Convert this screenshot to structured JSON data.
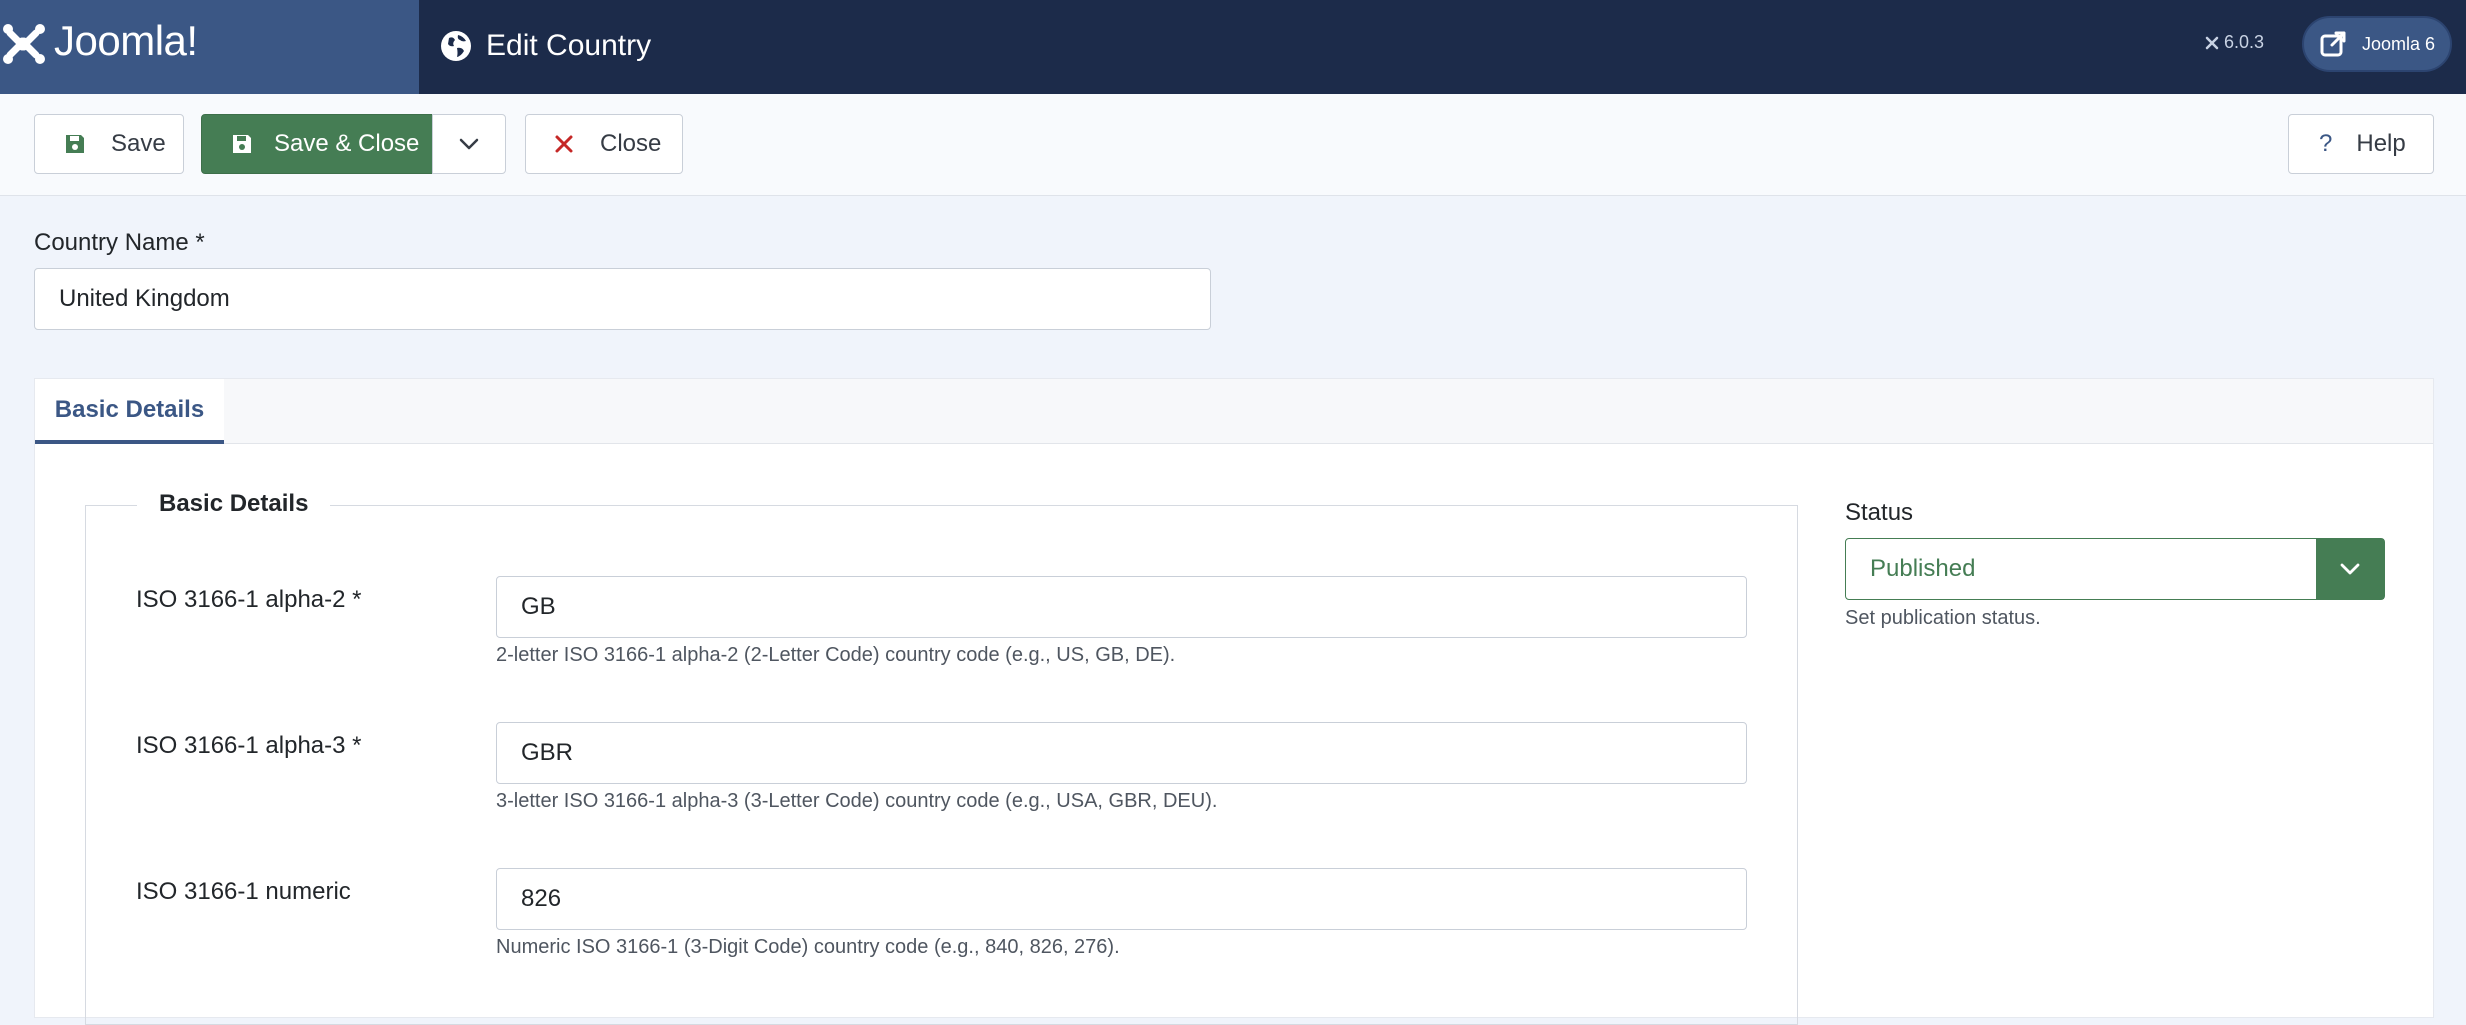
{
  "header": {
    "logo_text": "Joomla!",
    "title": "Edit Country",
    "version": "6.0.3",
    "site_button_label": "Joomla 6"
  },
  "toolbar": {
    "save_label": "Save",
    "save_close_label": "Save & Close",
    "close_label": "Close",
    "help_label": "Help"
  },
  "form": {
    "country_name_label": "Country Name *",
    "country_name_value": "United Kingdom"
  },
  "tabs": [
    {
      "label": "Basic Details",
      "active": true
    }
  ],
  "basic_details": {
    "legend": "Basic Details",
    "fields": [
      {
        "label": "ISO 3166-1 alpha-2 *",
        "value": "GB",
        "help": "2-letter ISO 3166-1 alpha-2 (2-Letter Code) country code (e.g., US, GB, DE)."
      },
      {
        "label": "ISO 3166-1 alpha-3 *",
        "value": "GBR",
        "help": "3-letter ISO 3166-1 alpha-3 (3-Letter Code) country code (e.g., USA, GBR, DEU)."
      },
      {
        "label": "ISO 3166-1 numeric",
        "value": "826",
        "help": "Numeric ISO 3166-1 (3-Digit Code) country code (e.g., 840, 826, 276)."
      }
    ]
  },
  "status": {
    "label": "Status",
    "selected": "Published",
    "help": "Set publication status."
  },
  "colors": {
    "header_bg": "#1c2b4a",
    "logo_bg": "#3b5785",
    "success": "#457d54",
    "danger": "#c52827",
    "accent": "#3b5785"
  }
}
